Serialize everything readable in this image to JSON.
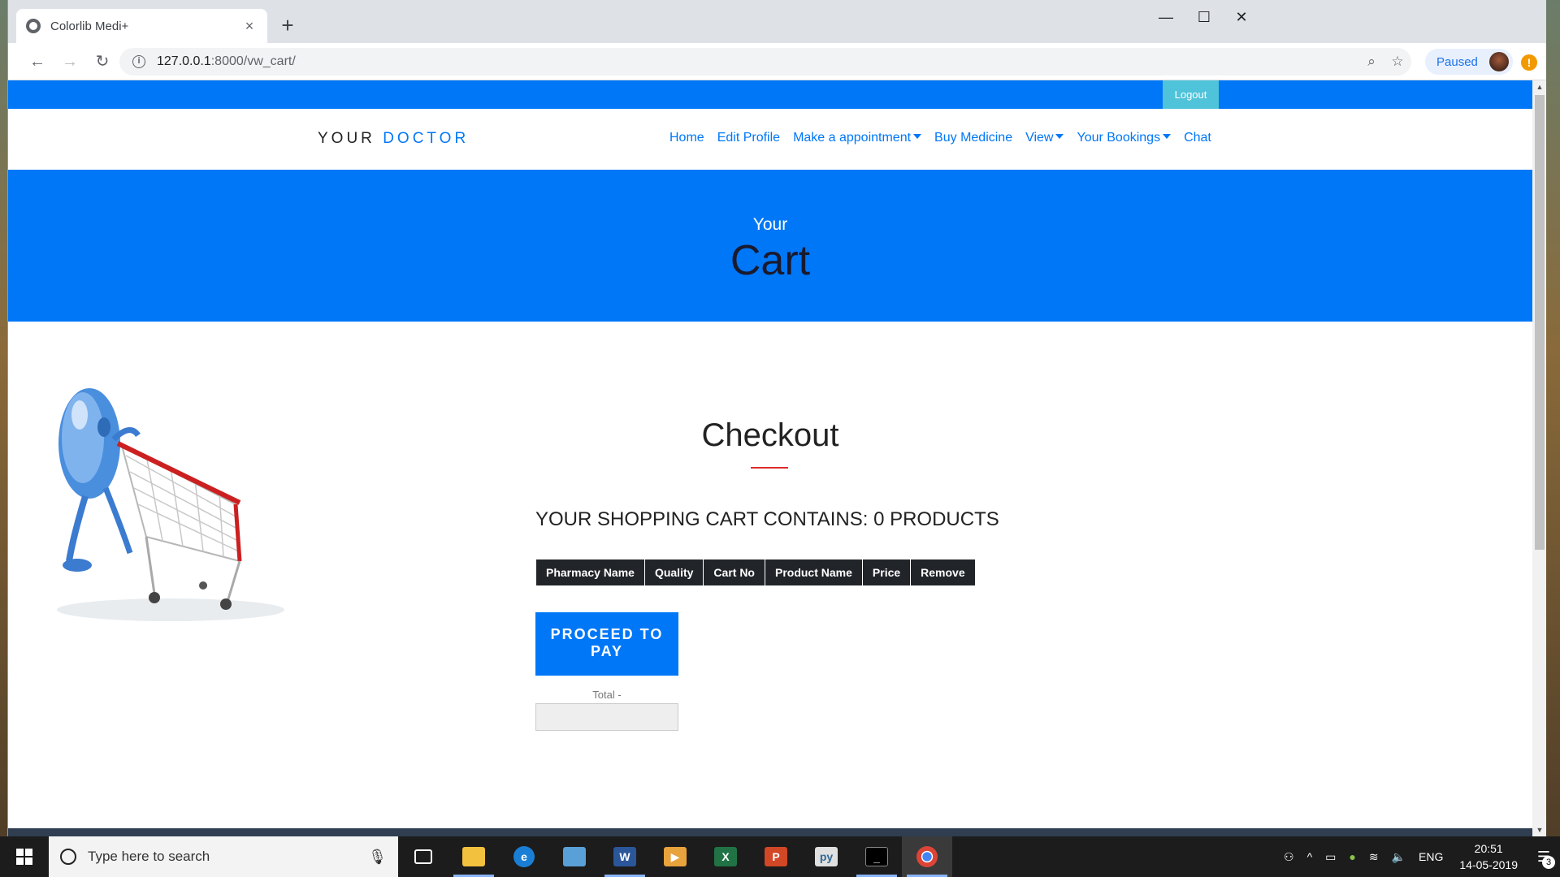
{
  "browser": {
    "tab_title": "Colorlib Medi+",
    "tab_close": "×",
    "new_tab": "+",
    "url_host": "127.0.0.1",
    "url_path": ":8000/vw_cart/",
    "profile_status": "Paused",
    "window_controls": {
      "minimize": "—",
      "maximize": "☐",
      "close": "✕"
    },
    "alert_badge": "!"
  },
  "site": {
    "logout_label": "Logout",
    "brand_primary": "YOUR",
    "brand_accent": "DOCTOR",
    "nav": {
      "home": "Home",
      "edit_profile": "Edit Profile",
      "make_appointment": "Make a appointment",
      "buy_medicine": "Buy Medicine",
      "view": "View",
      "your_bookings": "Your Bookings",
      "chat": "Chat"
    },
    "hero_subtitle": "Your",
    "hero_title": "Cart",
    "accent_color": "#0077f7",
    "logout_color": "#4fc3d9"
  },
  "checkout": {
    "title": "Checkout",
    "summary": "YOUR SHOPPING CART CONTAINS: 0 PRODUCTS",
    "columns": [
      "Pharmacy Name",
      "Quality",
      "Cart No",
      "Product Name",
      "Price",
      "Remove"
    ],
    "proceed_line1": "PROCEED TO",
    "proceed_line2": "PAY",
    "total_label": "Total -",
    "total_value": ""
  },
  "taskbar": {
    "search_placeholder": "Type here to search",
    "language": "ENG",
    "time": "20:51",
    "date": "14-05-2019",
    "notification_count": "3",
    "apps": [
      "task-view",
      "file-explorer",
      "edge",
      "outlook",
      "word",
      "media-player",
      "excel",
      "powerpoint",
      "python",
      "terminal",
      "chrome"
    ]
  }
}
